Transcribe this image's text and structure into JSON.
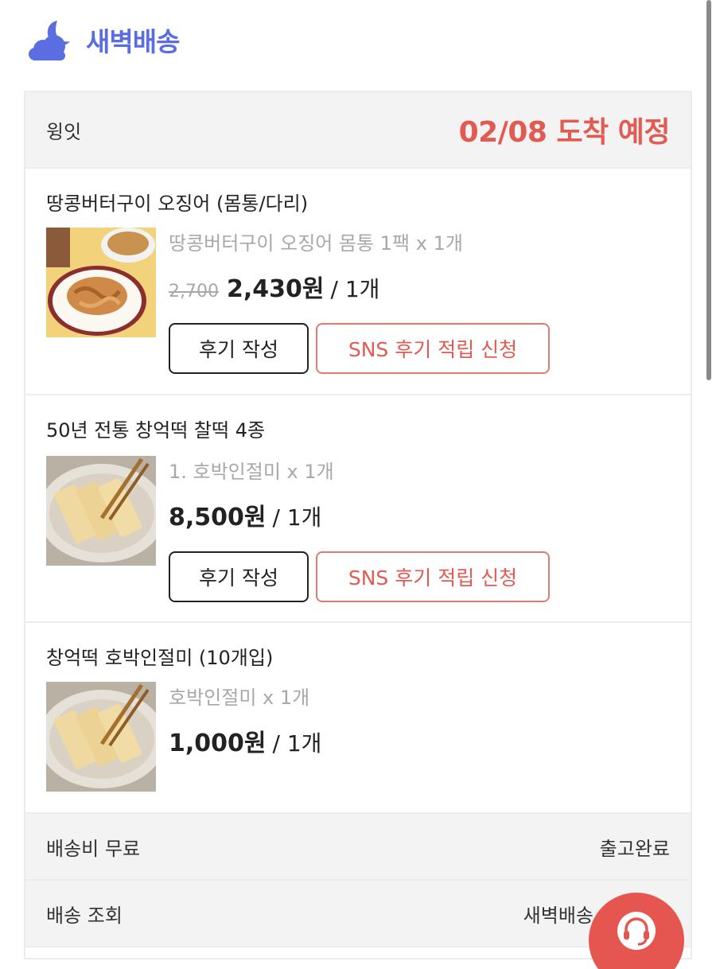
{
  "header": {
    "logo_icon": "moon-cloud-icon",
    "title": "새벽배송",
    "title_color": "#5b6ee1"
  },
  "order": {
    "seller": "윙잇",
    "arrival": "02/08 도착 예정",
    "arrival_color": "#e25a52",
    "items": [
      {
        "name": "땅콩버터구이 오징어 (몸통/다리)",
        "image": "squid-dish-image",
        "option": "땅콩버터구이 오징어 몸통 1팩 x 1개",
        "old_price": "2,700",
        "price": "2,430원",
        "qty": "/ 1개",
        "review_label": "후기 작성",
        "sns_label": "SNS 후기 적립 신청"
      },
      {
        "name": "50년 전통 창억떡 찰떡 4종",
        "image": "rice-cake-image",
        "option": "1. 호박인절미 x 1개",
        "price": "8,500원",
        "qty": "/ 1개",
        "review_label": "후기 작성",
        "sns_label": "SNS 후기 적립 신청"
      },
      {
        "name": "창억떡 호박인절미 (10개입)",
        "image": "rice-cake-image",
        "option": "호박인절미 x 1개",
        "price": "1,000원",
        "qty": "/ 1개"
      }
    ],
    "shipping_fee_label": "배송비 무료",
    "shipping_status": "출고완료",
    "tracking_label": "배송 조회",
    "tracking_value": "새벽배송"
  },
  "cs_button": {
    "icon": "headset-icon",
    "color": "#e4564f"
  }
}
